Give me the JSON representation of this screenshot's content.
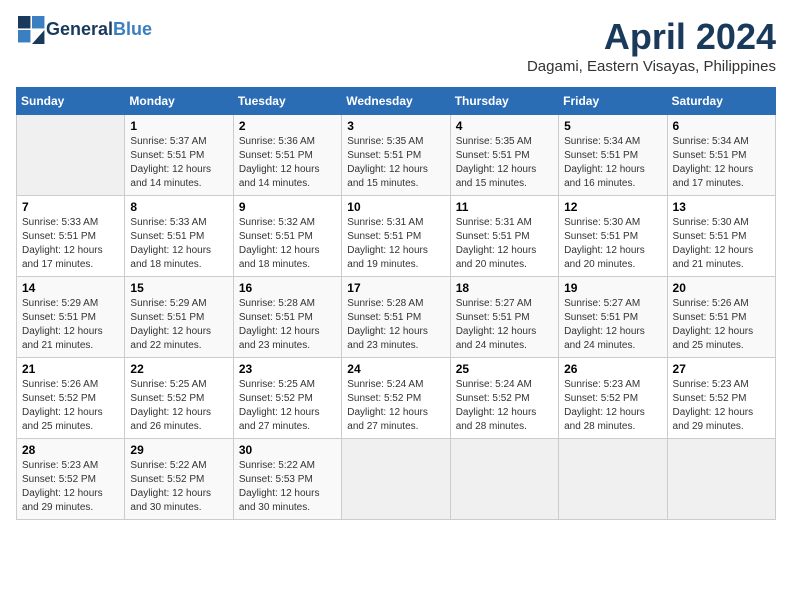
{
  "header": {
    "logo_line1": "General",
    "logo_line2": "Blue",
    "month_title": "April 2024",
    "subtitle": "Dagami, Eastern Visayas, Philippines"
  },
  "days_of_week": [
    "Sunday",
    "Monday",
    "Tuesday",
    "Wednesday",
    "Thursday",
    "Friday",
    "Saturday"
  ],
  "weeks": [
    [
      {
        "day": "",
        "info": ""
      },
      {
        "day": "1",
        "info": "Sunrise: 5:37 AM\nSunset: 5:51 PM\nDaylight: 12 hours\nand 14 minutes."
      },
      {
        "day": "2",
        "info": "Sunrise: 5:36 AM\nSunset: 5:51 PM\nDaylight: 12 hours\nand 14 minutes."
      },
      {
        "day": "3",
        "info": "Sunrise: 5:35 AM\nSunset: 5:51 PM\nDaylight: 12 hours\nand 15 minutes."
      },
      {
        "day": "4",
        "info": "Sunrise: 5:35 AM\nSunset: 5:51 PM\nDaylight: 12 hours\nand 15 minutes."
      },
      {
        "day": "5",
        "info": "Sunrise: 5:34 AM\nSunset: 5:51 PM\nDaylight: 12 hours\nand 16 minutes."
      },
      {
        "day": "6",
        "info": "Sunrise: 5:34 AM\nSunset: 5:51 PM\nDaylight: 12 hours\nand 17 minutes."
      }
    ],
    [
      {
        "day": "7",
        "info": "Sunrise: 5:33 AM\nSunset: 5:51 PM\nDaylight: 12 hours\nand 17 minutes."
      },
      {
        "day": "8",
        "info": "Sunrise: 5:33 AM\nSunset: 5:51 PM\nDaylight: 12 hours\nand 18 minutes."
      },
      {
        "day": "9",
        "info": "Sunrise: 5:32 AM\nSunset: 5:51 PM\nDaylight: 12 hours\nand 18 minutes."
      },
      {
        "day": "10",
        "info": "Sunrise: 5:31 AM\nSunset: 5:51 PM\nDaylight: 12 hours\nand 19 minutes."
      },
      {
        "day": "11",
        "info": "Sunrise: 5:31 AM\nSunset: 5:51 PM\nDaylight: 12 hours\nand 20 minutes."
      },
      {
        "day": "12",
        "info": "Sunrise: 5:30 AM\nSunset: 5:51 PM\nDaylight: 12 hours\nand 20 minutes."
      },
      {
        "day": "13",
        "info": "Sunrise: 5:30 AM\nSunset: 5:51 PM\nDaylight: 12 hours\nand 21 minutes."
      }
    ],
    [
      {
        "day": "14",
        "info": "Sunrise: 5:29 AM\nSunset: 5:51 PM\nDaylight: 12 hours\nand 21 minutes."
      },
      {
        "day": "15",
        "info": "Sunrise: 5:29 AM\nSunset: 5:51 PM\nDaylight: 12 hours\nand 22 minutes."
      },
      {
        "day": "16",
        "info": "Sunrise: 5:28 AM\nSunset: 5:51 PM\nDaylight: 12 hours\nand 23 minutes."
      },
      {
        "day": "17",
        "info": "Sunrise: 5:28 AM\nSunset: 5:51 PM\nDaylight: 12 hours\nand 23 minutes."
      },
      {
        "day": "18",
        "info": "Sunrise: 5:27 AM\nSunset: 5:51 PM\nDaylight: 12 hours\nand 24 minutes."
      },
      {
        "day": "19",
        "info": "Sunrise: 5:27 AM\nSunset: 5:51 PM\nDaylight: 12 hours\nand 24 minutes."
      },
      {
        "day": "20",
        "info": "Sunrise: 5:26 AM\nSunset: 5:51 PM\nDaylight: 12 hours\nand 25 minutes."
      }
    ],
    [
      {
        "day": "21",
        "info": "Sunrise: 5:26 AM\nSunset: 5:52 PM\nDaylight: 12 hours\nand 25 minutes."
      },
      {
        "day": "22",
        "info": "Sunrise: 5:25 AM\nSunset: 5:52 PM\nDaylight: 12 hours\nand 26 minutes."
      },
      {
        "day": "23",
        "info": "Sunrise: 5:25 AM\nSunset: 5:52 PM\nDaylight: 12 hours\nand 27 minutes."
      },
      {
        "day": "24",
        "info": "Sunrise: 5:24 AM\nSunset: 5:52 PM\nDaylight: 12 hours\nand 27 minutes."
      },
      {
        "day": "25",
        "info": "Sunrise: 5:24 AM\nSunset: 5:52 PM\nDaylight: 12 hours\nand 28 minutes."
      },
      {
        "day": "26",
        "info": "Sunrise: 5:23 AM\nSunset: 5:52 PM\nDaylight: 12 hours\nand 28 minutes."
      },
      {
        "day": "27",
        "info": "Sunrise: 5:23 AM\nSunset: 5:52 PM\nDaylight: 12 hours\nand 29 minutes."
      }
    ],
    [
      {
        "day": "28",
        "info": "Sunrise: 5:23 AM\nSunset: 5:52 PM\nDaylight: 12 hours\nand 29 minutes."
      },
      {
        "day": "29",
        "info": "Sunrise: 5:22 AM\nSunset: 5:52 PM\nDaylight: 12 hours\nand 30 minutes."
      },
      {
        "day": "30",
        "info": "Sunrise: 5:22 AM\nSunset: 5:53 PM\nDaylight: 12 hours\nand 30 minutes."
      },
      {
        "day": "",
        "info": ""
      },
      {
        "day": "",
        "info": ""
      },
      {
        "day": "",
        "info": ""
      },
      {
        "day": "",
        "info": ""
      }
    ]
  ]
}
